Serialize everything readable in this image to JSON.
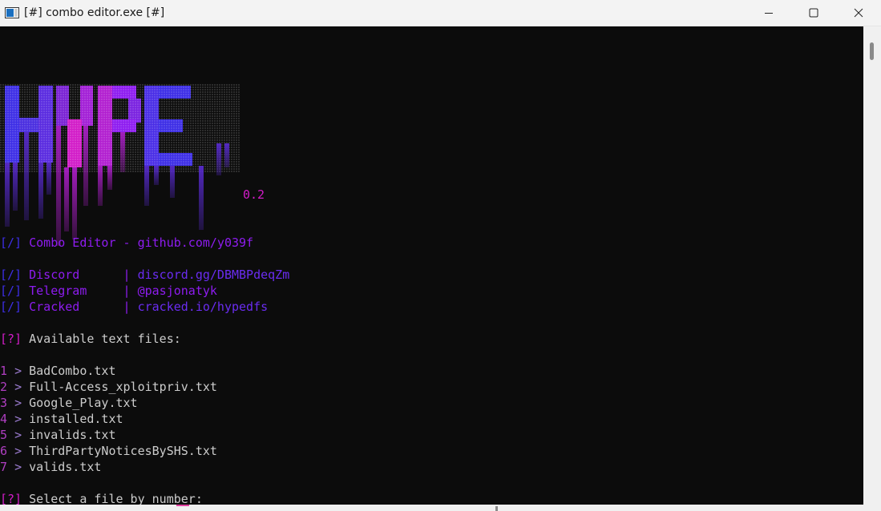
{
  "window": {
    "title": "[#] combo editor.exe [#]",
    "controls": [
      "minimize-icon",
      "maximize-icon",
      "close-icon"
    ]
  },
  "logo": {
    "text": "HYPE",
    "colors": [
      "#3d2ee6",
      "#7a22d4",
      "#c41fd0",
      "#d21cc8"
    ]
  },
  "version": "0.2",
  "header": {
    "bracket": "[/]",
    "text": "Combo Editor - github.com/y039f"
  },
  "links": [
    {
      "bracket": "[/]",
      "label": "Discord      ",
      "sep": "|",
      "value": "discord.gg/DBMBPdeqZm"
    },
    {
      "bracket": "[/]",
      "label": "Telegram     ",
      "sep": "|",
      "value": "@pasjonatyk"
    },
    {
      "bracket": "[/]",
      "label": "Cracked      ",
      "sep": "|",
      "value": "cracked.io/hypedfs"
    }
  ],
  "files_prompt": {
    "bracket": "[?]",
    "text": "Available text files:"
  },
  "files": [
    {
      "num": "1",
      "name": "BadCombo.txt"
    },
    {
      "num": "2",
      "name": "Full-Access_xploitpriv.txt"
    },
    {
      "num": "3",
      "name": "Google_Play.txt"
    },
    {
      "num": "4",
      "name": "installed.txt"
    },
    {
      "num": "5",
      "name": "invalids.txt"
    },
    {
      "num": "6",
      "name": "ThirdPartyNoticesBySHS.txt"
    },
    {
      "num": "7",
      "name": "valids.txt"
    }
  ],
  "select_prompt": {
    "bracket": "[?]",
    "text": "Select a file by number:"
  }
}
